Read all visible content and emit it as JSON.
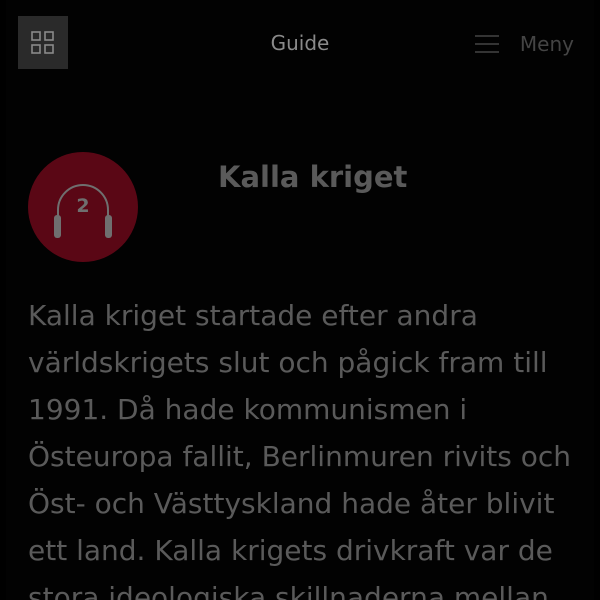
{
  "header": {
    "title": "Guide",
    "menu_label": "Meny",
    "grid_icon": "grid-icon",
    "menu_icon": "hamburger-icon"
  },
  "audio": {
    "track_number": "2",
    "icon": "headphones-icon",
    "badge_color": "#5a0715"
  },
  "article": {
    "title": "Kalla kriget",
    "body": "Kalla kriget startade efter andra världskrigets slut och pågick fram till 1991. Då hade kommunismen i Östeuropa fallit, Berlinmuren rivits och Öst- och Västtyskland hade åter blivit ett land. Kalla krigets drivkraft var de stora ideologiska skillnaderna mellan"
  },
  "colors": {
    "background": "#020202",
    "text": "#5a5a5a",
    "accent": "#5a0715"
  }
}
